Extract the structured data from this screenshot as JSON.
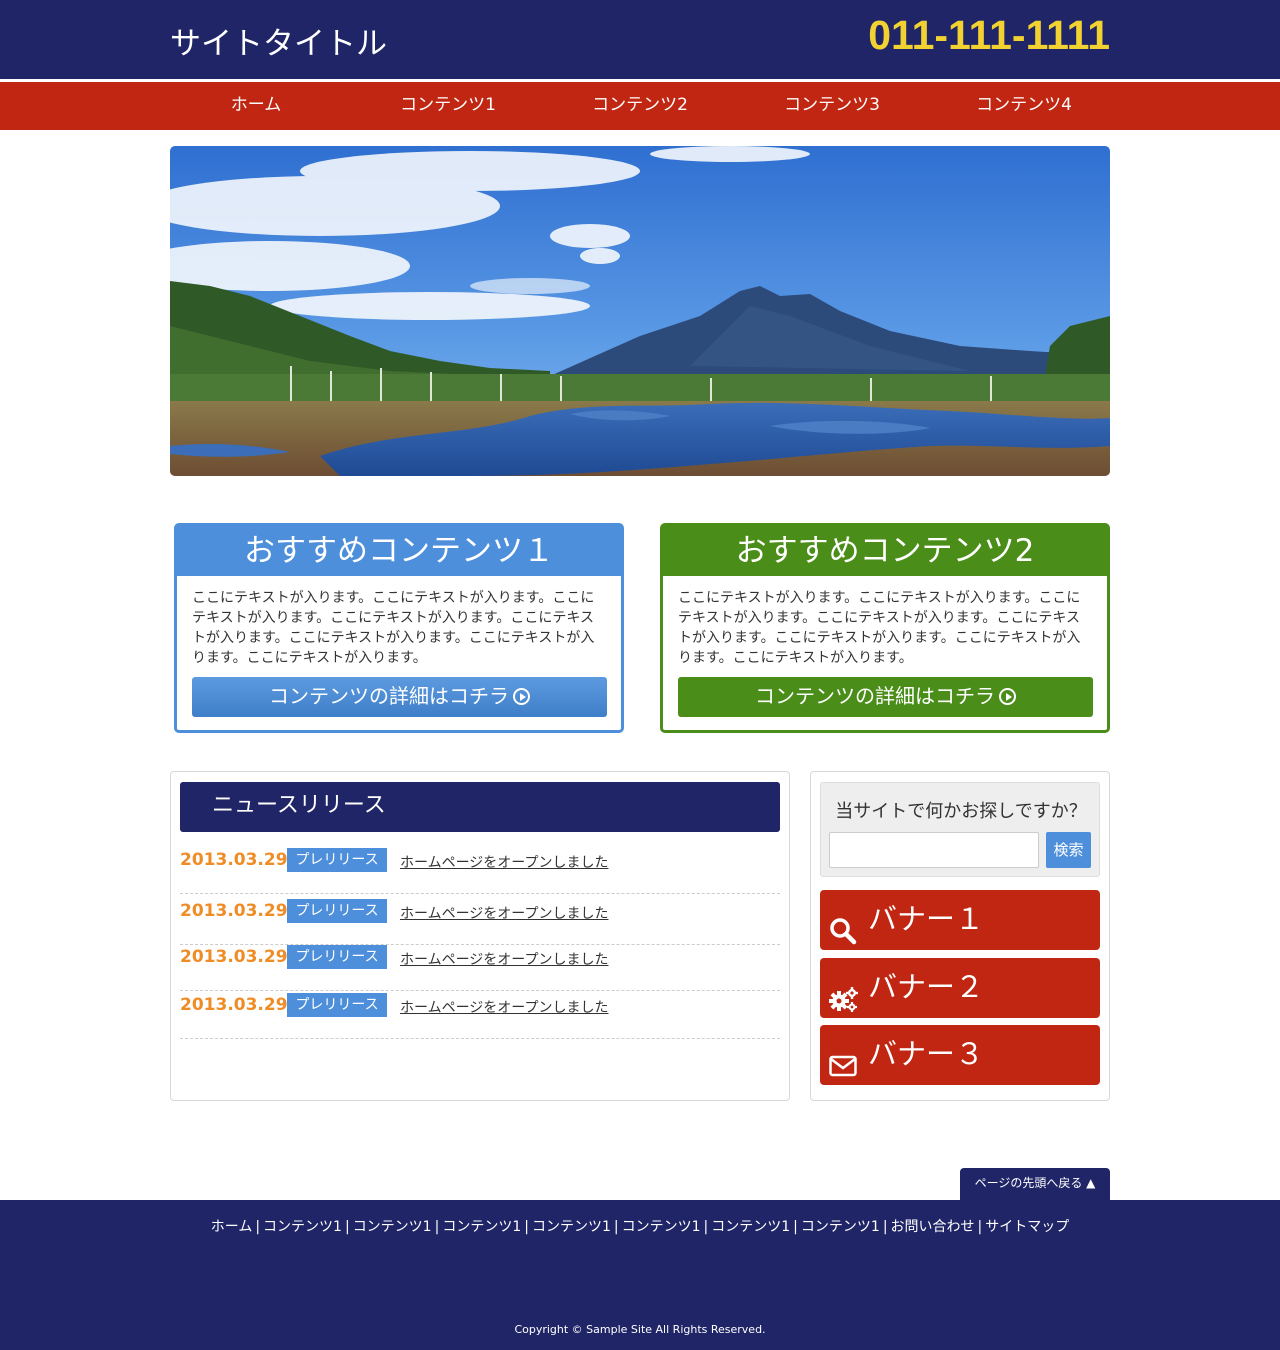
{
  "header": {
    "site_title": "サイトタイトル",
    "phone": "011-111-1111"
  },
  "nav": {
    "items": [
      "ホーム",
      "コンテンツ1",
      "コンテンツ2",
      "コンテンツ3",
      "コンテンツ4"
    ]
  },
  "recommend": [
    {
      "title": "おすすめコンテンツ１",
      "text": "ここにテキストが入ります。ここにテキストが入ります。ここにテキストが入ります。ここにテキストが入ります。ここにテキストが入ります。ここにテキストが入ります。ここにテキストが入ります。ここにテキストが入ります。",
      "button": "コンテンツの詳細はコチラ"
    },
    {
      "title": "おすすめコンテンツ2",
      "text": "ここにテキストが入ります。ここにテキストが入ります。ここにテキストが入ります。ここにテキストが入ります。ここにテキストが入ります。ここにテキストが入ります。ここにテキストが入ります。ここにテキストが入ります。",
      "button": "コンテンツの詳細はコチラ"
    }
  ],
  "news": {
    "heading": "ニュースリリース",
    "items": [
      {
        "date": "2013.03.29",
        "tag": "プレリリース",
        "title": "ホームページをオープンしました"
      },
      {
        "date": "2013.03.29",
        "tag": "プレリリース",
        "title": "ホームページをオープンしました"
      },
      {
        "date": "2013.03.29",
        "tag": "プレリリース",
        "title": "ホームページをオープンしました"
      },
      {
        "date": "2013.03.29",
        "tag": "プレリリース",
        "title": "ホームページをオープンしました"
      }
    ]
  },
  "search": {
    "title": "当サイトで何かお探しですか？",
    "input_value": "",
    "button": "検索"
  },
  "banners": [
    {
      "label": "バナー１",
      "icon": "search-icon"
    },
    {
      "label": "バナー２",
      "icon": "gears-icon"
    },
    {
      "label": "バナー３",
      "icon": "envelope-icon"
    }
  ],
  "pagetop": "ページの先頭へ戻る ▲",
  "footer": {
    "links": [
      "ホーム",
      "コンテンツ1",
      "コンテンツ1",
      "コンテンツ1",
      "コンテンツ1",
      "コンテンツ1",
      "コンテンツ1",
      "コンテンツ1",
      "お問い合わせ",
      "サイトマップ"
    ],
    "separator": "|",
    "copyright": "Copyright © Sample Site All Rights Reserved."
  },
  "colors": {
    "navy": "#1f2566",
    "red": "#c02612",
    "yellow": "#f2d231",
    "blue": "#4e8fdb",
    "green": "#4a8e19",
    "orange": "#f08c26"
  }
}
